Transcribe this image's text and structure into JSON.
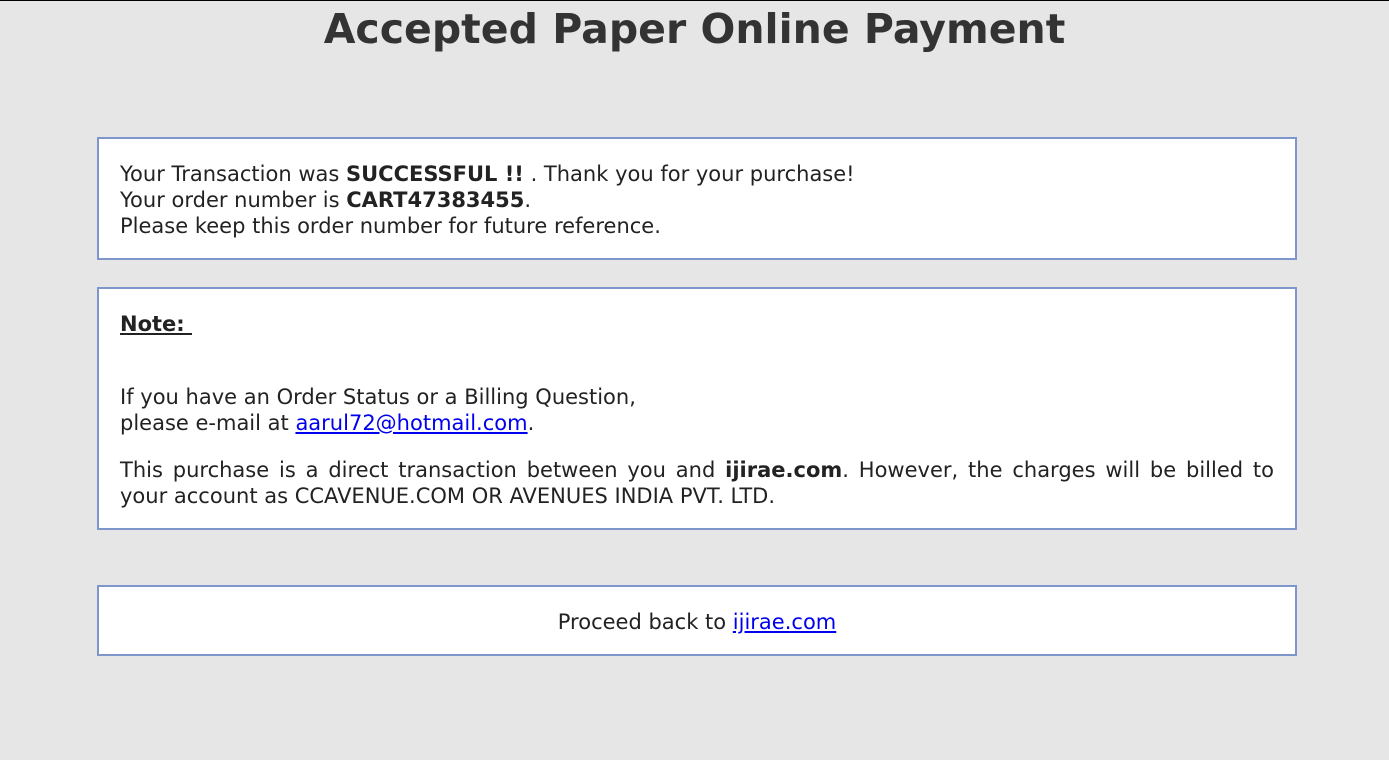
{
  "page": {
    "title": "Accepted Paper Online Payment"
  },
  "transaction": {
    "line1_prefix": "Your Transaction was ",
    "status": "SUCCESSFUL !!",
    "line1_suffix": " . Thank you for your purchase!",
    "line2_prefix": "Your order number is ",
    "order_number": "CART47383455",
    "line2_suffix": ".",
    "line3": "Please keep this order number for future reference."
  },
  "note": {
    "heading": "Note: ",
    "question_line": "If you have an Order Status or a Billing Question,",
    "email_prefix": "please e-mail at ",
    "email": "aarul72@hotmail.com",
    "email_suffix": ".",
    "purchase_prefix": "This purchase is a direct transaction between you and ",
    "merchant": "ijirae.com",
    "purchase_suffix": ". However, the charges will be billed to your account as CCAVENUE.COM OR AVENUES INDIA PVT. LTD."
  },
  "proceed": {
    "prefix": "Proceed back to ",
    "link_label": "ijirae.com"
  },
  "colors": {
    "background": "#e6e6e6",
    "box_border": "#7f96cc",
    "link": "#0000ee",
    "title": "#333333"
  }
}
